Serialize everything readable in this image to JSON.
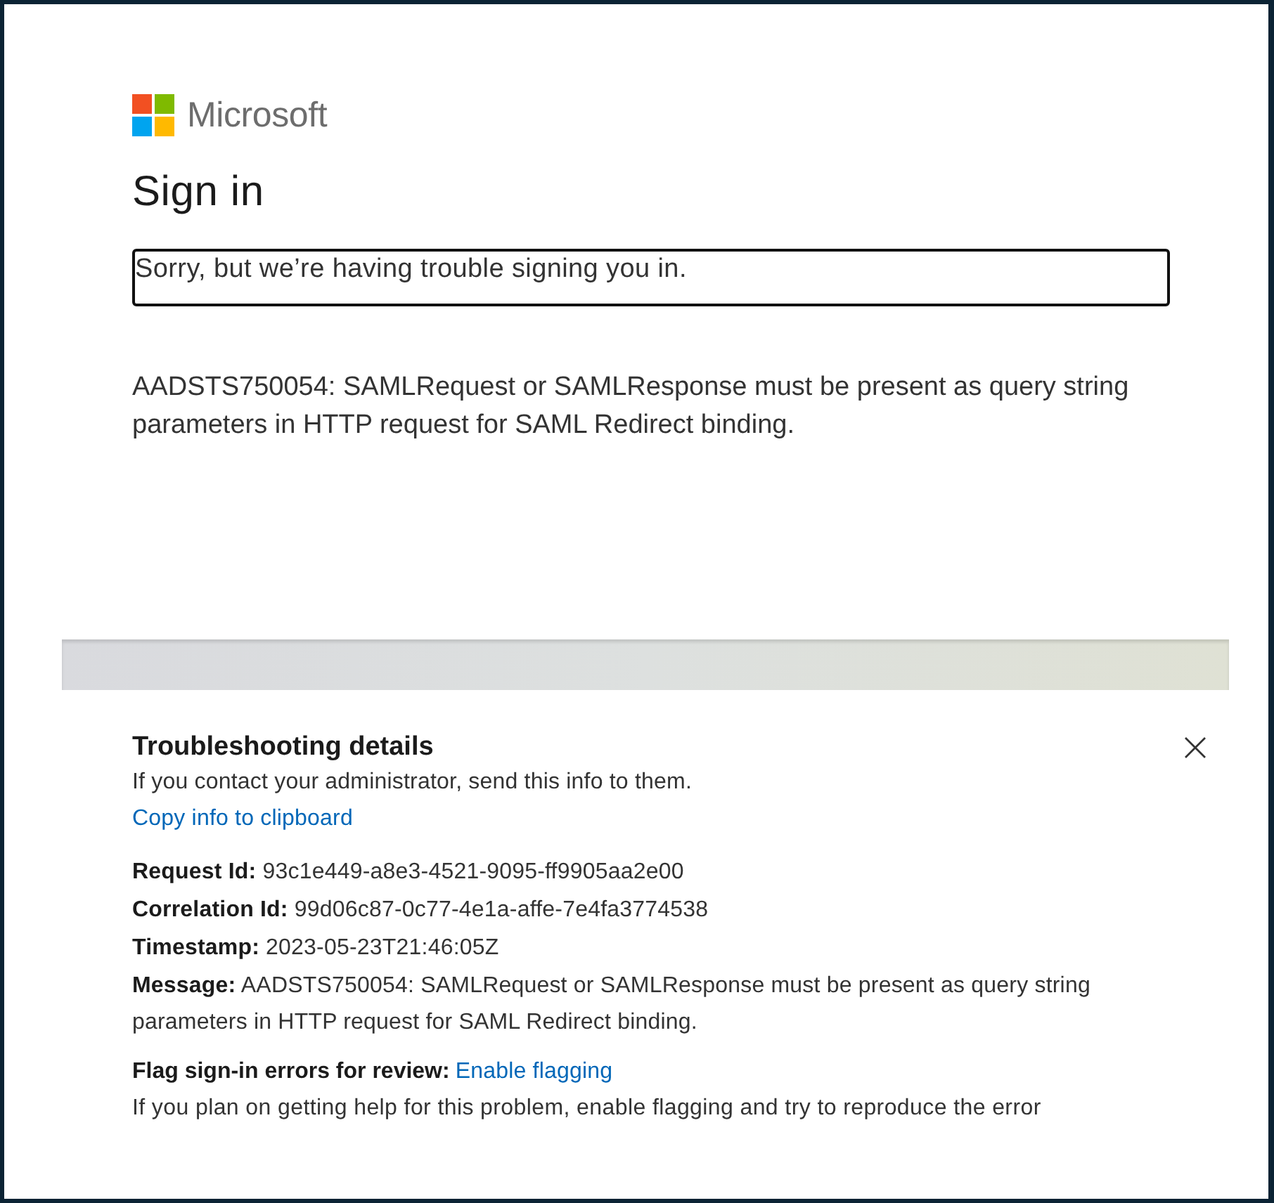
{
  "logo": {
    "text": "Microsoft"
  },
  "title": "Sign in",
  "alert": {
    "text": "Sorry, but we’re having trouble signing you in."
  },
  "error_text": "AADSTS750054: SAMLRequest or SAMLResponse must be present as query string parameters in HTTP request for SAML Redirect binding.",
  "troubleshooting": {
    "title": "Troubleshooting details",
    "subtitle": "If you contact your administrator, send this info to them.",
    "copy_link": "Copy info to clipboard",
    "details": [
      "**Request Id:** 93c1e449-a8e3-4521-9095-ff9905aa2e00",
      "**Correlation Id:** 99d06c87-0c77-4e1a-affe-7e4fa3774538",
      "**Timestamp:** 2023-05-23T21:46:05Z",
      "**Message:** AADSTS750054: SAMLRequest or SAMLResponse must be present as query string parameters in HTTP request for SAML Redirect binding."
    ],
    "flag": {
      "label": "Flag sign-in errors for review:",
      "link": "Enable flagging"
    },
    "help_text": "If you plan on getting help for this problem, enable flagging and try to reproduce the error"
  }
}
